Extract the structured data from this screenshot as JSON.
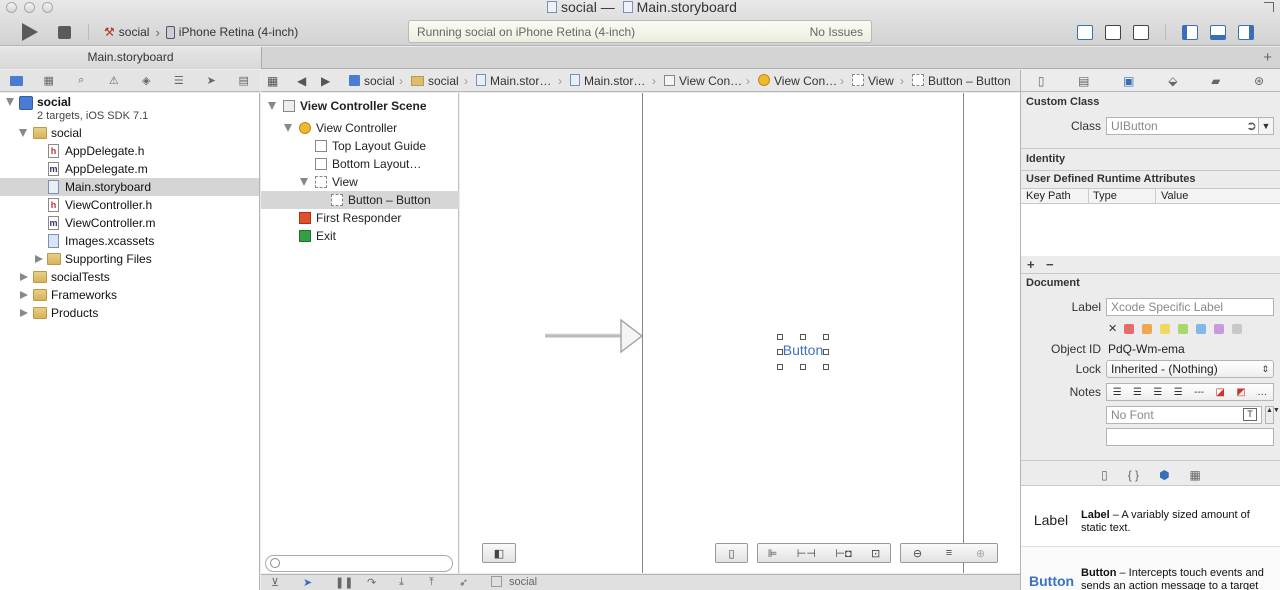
{
  "window": {
    "project": "social",
    "separator": "—",
    "file": "Main.storyboard"
  },
  "toolbar": {
    "scheme": "social",
    "destination": "iPhone Retina (4-inch)",
    "activity_status": "Running social on iPhone Retina (4-inch)",
    "activity_issues": "No Issues"
  },
  "tabs": {
    "main": "Main.storyboard",
    "plus": "+"
  },
  "navigator": {
    "project_name": "social",
    "project_sub": "2 targets, iOS SDK 7.1",
    "group": "social",
    "files": [
      {
        "name": "AppDelegate.h",
        "kind": "h"
      },
      {
        "name": "AppDelegate.m",
        "kind": "m"
      },
      {
        "name": "Main.storyboard",
        "kind": "storyboard"
      },
      {
        "name": "ViewController.h",
        "kind": "h"
      },
      {
        "name": "ViewController.m",
        "kind": "m"
      },
      {
        "name": "Images.xcassets",
        "kind": "xcassets"
      },
      {
        "name": "Supporting Files",
        "kind": "folder"
      }
    ],
    "groups": [
      "socialTests",
      "Frameworks",
      "Products"
    ]
  },
  "jumpbar": [
    "social",
    "social",
    "Main.stor…",
    "Main.stor…",
    "View Con…",
    "View Con…",
    "View",
    "Button – Button"
  ],
  "outline": {
    "scene": "View Controller Scene",
    "view_controller": "View Controller",
    "top_layout": "Top Layout Guide",
    "bottom_layout": "Bottom Layout…",
    "view": "View",
    "button": "Button – Button",
    "first_responder": "First Responder",
    "exit": "Exit"
  },
  "canvas": {
    "button_label": "Button"
  },
  "debugbar": {
    "target": "social"
  },
  "inspector": {
    "custom_class": {
      "heading": "Custom Class",
      "label": "Class",
      "placeholder": "UIButton"
    },
    "identity": {
      "heading": "Identity"
    },
    "udra": {
      "heading": "User Defined Runtime Attributes",
      "columns": [
        "Key Path",
        "Type",
        "Value"
      ],
      "add": "+",
      "remove": "−"
    },
    "document": {
      "heading": "Document",
      "label_label": "Label",
      "label_placeholder": "Xcode Specific Label",
      "swatch_clear": "✕",
      "object_id_label": "Object ID",
      "object_id": "PdQ-Wm-ema",
      "lock_label": "Lock",
      "lock_value": "Inherited - (Nothing)",
      "notes_label": "Notes",
      "font_placeholder": "No Font"
    },
    "colors": [
      "#e86a6a",
      "#f0a850",
      "#f0d860",
      "#a8d868",
      "#80b8e8",
      "#c898e0",
      "#c8c8c8"
    ]
  },
  "library": [
    {
      "icon": "Label",
      "title": "Label",
      "desc": " – A variably sized amount of static text."
    },
    {
      "icon": "Button",
      "title": "Button",
      "desc": " – Intercepts touch events and sends an action message to a target"
    }
  ]
}
